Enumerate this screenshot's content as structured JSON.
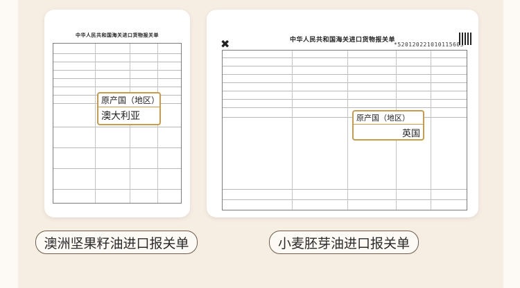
{
  "colors": {
    "panel": "#f6ede3",
    "accent": "#c99a4a",
    "caption_border": "#6e5a46"
  },
  "left_card": {
    "doc_title": "中华人民共和国海关进口货物报关单",
    "callout_label": "原产国（地区）",
    "callout_value": "澳大利亚",
    "caption": "澳洲坚果籽油进口报关单"
  },
  "right_card": {
    "doc_title": "中华人民共和国海关进口货物报关单",
    "barcode_number": "*520120221010115603*",
    "callout_label": "原产国（地区）",
    "callout_value": "英国",
    "caption": "小麦胚芽油进口报关单"
  }
}
